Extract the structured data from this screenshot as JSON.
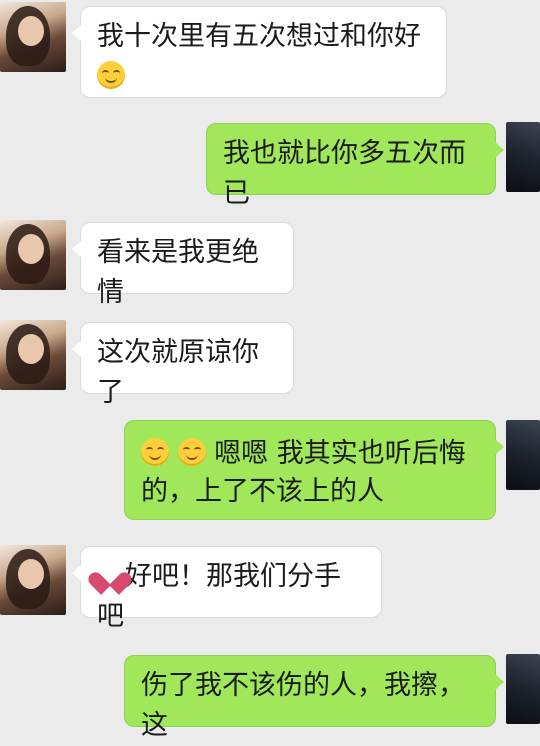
{
  "messages": [
    {
      "from": "left",
      "text1": "我十次里有五次想过和你好",
      "emoji": "smile-emoji"
    },
    {
      "from": "right",
      "text": "我也就比你多五次而已"
    },
    {
      "from": "left",
      "text": "看来是我更绝情"
    },
    {
      "from": "left",
      "text": "这次就原谅你了"
    },
    {
      "from": "right",
      "line1": "嗯嗯 我其实也听后悔",
      "line2": "的，上了不该上的人",
      "emojis": [
        "smile-emoji",
        "smile-emoji"
      ]
    },
    {
      "from": "left",
      "text": "好吧！那我们分手吧",
      "emoji": "broken-heart-emoji"
    },
    {
      "from": "right",
      "text": "伤了我不该伤的人，我擦，这"
    }
  ],
  "colors": {
    "background": "#ebebeb",
    "incoming_bubble": "#ffffff",
    "outgoing_bubble": "#a0e75a"
  }
}
